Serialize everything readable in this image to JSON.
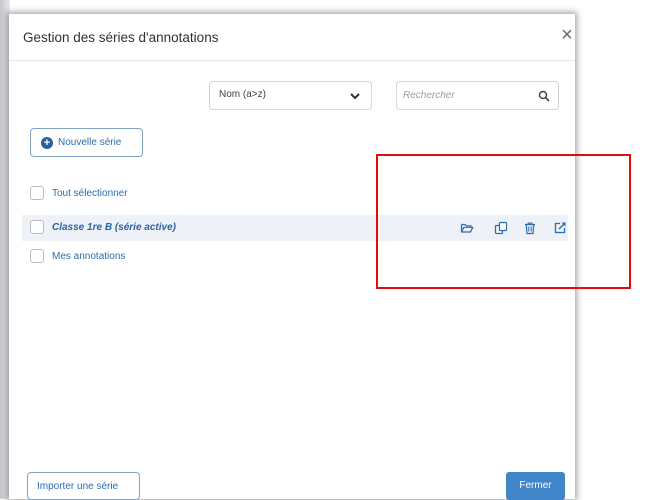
{
  "dialog": {
    "title": "Gestion des séries d'annotations",
    "close_glyph": "×"
  },
  "toolbar": {
    "sort_value": "Nom (a>z)",
    "search_placeholder": "Rechercher"
  },
  "new_series_button": {
    "label": "Nouvelle série"
  },
  "select_all": {
    "label": "Tout sélectionner",
    "checked": false
  },
  "series": [
    {
      "label": "Classe 1re B (série active)",
      "active": true,
      "checked": false,
      "actions": [
        "open-folder-icon",
        "duplicate-icon",
        "trash-icon",
        "external-link-icon"
      ]
    },
    {
      "label": "Mes annotations",
      "active": false,
      "checked": false
    }
  ],
  "footer": {
    "import_label": "Importer une série",
    "close_label": "Fermer"
  },
  "colors": {
    "accent": "#2b6cb0",
    "primary_button": "#3f85c8",
    "highlight_box": "#e00d0d",
    "active_row": "#eef1f5"
  }
}
